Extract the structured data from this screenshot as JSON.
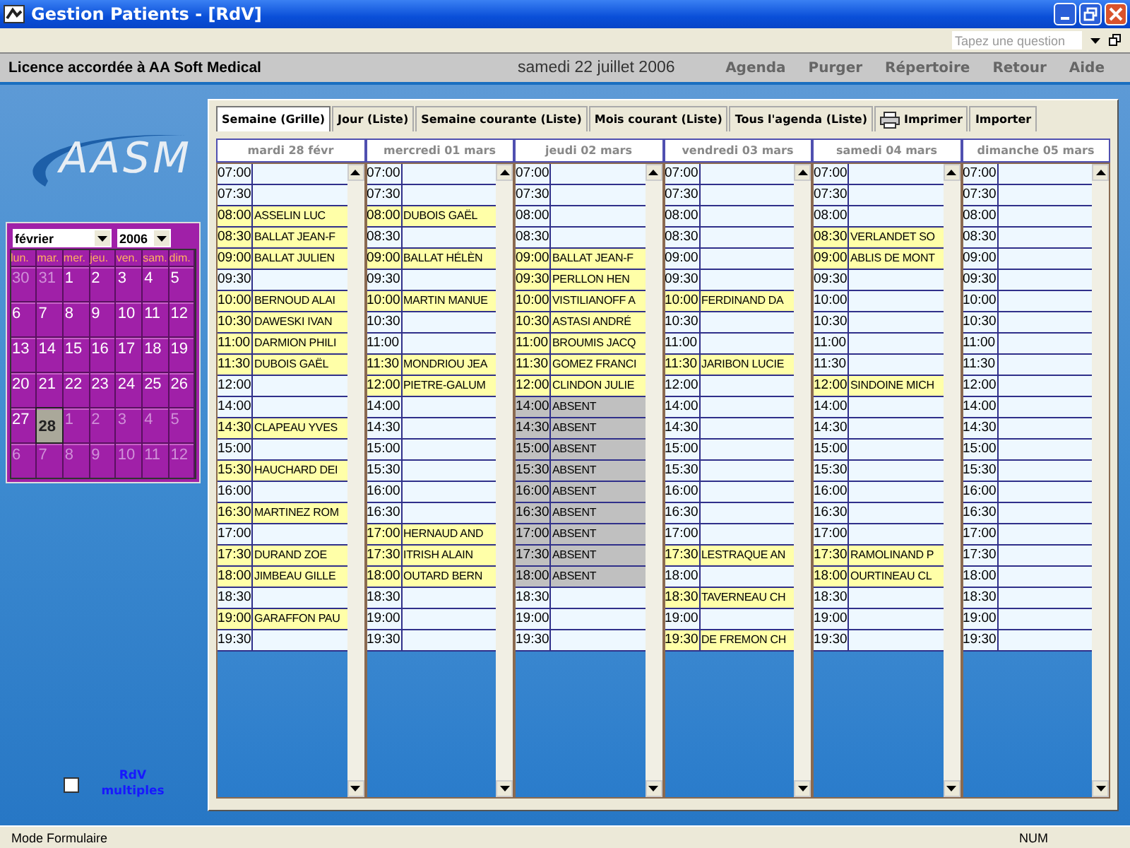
{
  "window": {
    "title": "Gestion Patients - [RdV]"
  },
  "help_box": {
    "placeholder": "Tapez une question"
  },
  "header": {
    "licence": "Licence accordée à  AA Soft Medical",
    "date": "samedi 22 juillet 2006",
    "links": [
      "Agenda",
      "Purger",
      "Répertoire",
      "Retour",
      "Aide"
    ]
  },
  "logo": {
    "text": "AASM"
  },
  "calendar": {
    "month": "février",
    "year": "2006",
    "weekdays": [
      "lun.",
      "mar.",
      "mer.",
      "jeu.",
      "ven.",
      "sam.",
      "dim."
    ],
    "weeks": [
      [
        {
          "day": "30",
          "other_month": true,
          "selected": false
        },
        {
          "day": "31",
          "other_month": true,
          "selected": false
        },
        {
          "day": "1",
          "other_month": false,
          "selected": false
        },
        {
          "day": "2",
          "other_month": false,
          "selected": false
        },
        {
          "day": "3",
          "other_month": false,
          "selected": false
        },
        {
          "day": "4",
          "other_month": false,
          "selected": false
        },
        {
          "day": "5",
          "other_month": false,
          "selected": false
        }
      ],
      [
        {
          "day": "6",
          "other_month": false,
          "selected": false
        },
        {
          "day": "7",
          "other_month": false,
          "selected": false
        },
        {
          "day": "8",
          "other_month": false,
          "selected": false
        },
        {
          "day": "9",
          "other_month": false,
          "selected": false
        },
        {
          "day": "10",
          "other_month": false,
          "selected": false
        },
        {
          "day": "11",
          "other_month": false,
          "selected": false
        },
        {
          "day": "12",
          "other_month": false,
          "selected": false
        }
      ],
      [
        {
          "day": "13",
          "other_month": false,
          "selected": false
        },
        {
          "day": "14",
          "other_month": false,
          "selected": false
        },
        {
          "day": "15",
          "other_month": false,
          "selected": false
        },
        {
          "day": "16",
          "other_month": false,
          "selected": false
        },
        {
          "day": "17",
          "other_month": false,
          "selected": false
        },
        {
          "day": "18",
          "other_month": false,
          "selected": false
        },
        {
          "day": "19",
          "other_month": false,
          "selected": false
        }
      ],
      [
        {
          "day": "20",
          "other_month": false,
          "selected": false
        },
        {
          "day": "21",
          "other_month": false,
          "selected": false
        },
        {
          "day": "22",
          "other_month": false,
          "selected": false
        },
        {
          "day": "23",
          "other_month": false,
          "selected": false
        },
        {
          "day": "24",
          "other_month": false,
          "selected": false
        },
        {
          "day": "25",
          "other_month": false,
          "selected": false
        },
        {
          "day": "26",
          "other_month": false,
          "selected": false
        }
      ],
      [
        {
          "day": "27",
          "other_month": false,
          "selected": false
        },
        {
          "day": "28",
          "other_month": false,
          "selected": true
        },
        {
          "day": "1",
          "other_month": true,
          "selected": false
        },
        {
          "day": "2",
          "other_month": true,
          "selected": false
        },
        {
          "day": "3",
          "other_month": true,
          "selected": false
        },
        {
          "day": "4",
          "other_month": true,
          "selected": false
        },
        {
          "day": "5",
          "other_month": true,
          "selected": false
        }
      ],
      [
        {
          "day": "6",
          "other_month": true,
          "selected": false
        },
        {
          "day": "7",
          "other_month": true,
          "selected": false
        },
        {
          "day": "8",
          "other_month": true,
          "selected": false
        },
        {
          "day": "9",
          "other_month": true,
          "selected": false
        },
        {
          "day": "10",
          "other_month": true,
          "selected": false
        },
        {
          "day": "11",
          "other_month": true,
          "selected": false
        },
        {
          "day": "12",
          "other_month": true,
          "selected": false
        }
      ]
    ]
  },
  "multiple_appointments": {
    "label": "RdV multiples",
    "checked": false
  },
  "tabs": [
    {
      "label": "Semaine (Grille)",
      "kind": "text",
      "selected": true
    },
    {
      "label": "Jour (Liste)",
      "kind": "text",
      "selected": false
    },
    {
      "label": "Semaine courante (Liste)",
      "kind": "text",
      "selected": false
    },
    {
      "label": "Mois courant (Liste)",
      "kind": "text",
      "selected": false
    },
    {
      "label": "Tous l'agenda (Liste)",
      "kind": "text",
      "selected": false
    },
    {
      "label": "Imprimer",
      "kind": "print",
      "selected": false
    },
    {
      "label": "Importer",
      "kind": "text",
      "selected": false
    }
  ],
  "days": [
    {
      "header": "mardi 28 févr",
      "slots": [
        {
          "time": "07:00",
          "kind": "free"
        },
        {
          "time": "07:30",
          "kind": "free"
        },
        {
          "time": "08:00",
          "kind": "booked",
          "name": "ASSELIN LUC"
        },
        {
          "time": "08:30",
          "kind": "booked",
          "name": "BALLAT JEAN-F"
        },
        {
          "time": "09:00",
          "kind": "booked",
          "name": "BALLAT JULIEN"
        },
        {
          "time": "09:30",
          "kind": "free"
        },
        {
          "time": "10:00",
          "kind": "booked",
          "name": "BERNOUD ALAI"
        },
        {
          "time": "10:30",
          "kind": "booked",
          "name": "DAWESKI IVAN"
        },
        {
          "time": "11:00",
          "kind": "booked",
          "name": "DARMION PHILI"
        },
        {
          "time": "11:30",
          "kind": "booked",
          "name": "DUBOIS GAËL"
        },
        {
          "time": "12:00",
          "kind": "free"
        },
        {
          "time": "14:00",
          "kind": "free"
        },
        {
          "time": "14:30",
          "kind": "booked",
          "name": "CLAPEAU YVES"
        },
        {
          "time": "15:00",
          "kind": "free"
        },
        {
          "time": "15:30",
          "kind": "booked",
          "name": "HAUCHARD DEI"
        },
        {
          "time": "16:00",
          "kind": "free"
        },
        {
          "time": "16:30",
          "kind": "booked",
          "name": "MARTINEZ ROM"
        },
        {
          "time": "17:00",
          "kind": "free"
        },
        {
          "time": "17:30",
          "kind": "booked",
          "name": "DURAND ZOE"
        },
        {
          "time": "18:00",
          "kind": "booked",
          "name": "JIMBEAU GILLE"
        },
        {
          "time": "18:30",
          "kind": "free"
        },
        {
          "time": "19:00",
          "kind": "booked",
          "name": "GARAFFON PAU"
        },
        {
          "time": "19:30",
          "kind": "free"
        }
      ]
    },
    {
      "header": "mercredi 01 mars",
      "slots": [
        {
          "time": "07:00",
          "kind": "free"
        },
        {
          "time": "07:30",
          "kind": "free"
        },
        {
          "time": "08:00",
          "kind": "booked",
          "name": "DUBOIS GAËL"
        },
        {
          "time": "08:30",
          "kind": "free"
        },
        {
          "time": "09:00",
          "kind": "booked",
          "name": "BALLAT HÉLÈN"
        },
        {
          "time": "09:30",
          "kind": "free"
        },
        {
          "time": "10:00",
          "kind": "booked",
          "name": "MARTIN MANUE"
        },
        {
          "time": "10:30",
          "kind": "free"
        },
        {
          "time": "11:00",
          "kind": "free"
        },
        {
          "time": "11:30",
          "kind": "booked",
          "name": "MONDRIOU JEA"
        },
        {
          "time": "12:00",
          "kind": "booked",
          "name": "PIETRE-GALUM"
        },
        {
          "time": "14:00",
          "kind": "free"
        },
        {
          "time": "14:30",
          "kind": "free"
        },
        {
          "time": "15:00",
          "kind": "free"
        },
        {
          "time": "15:30",
          "kind": "free"
        },
        {
          "time": "16:00",
          "kind": "free"
        },
        {
          "time": "16:30",
          "kind": "free"
        },
        {
          "time": "17:00",
          "kind": "booked",
          "name": "HERNAUD AND"
        },
        {
          "time": "17:30",
          "kind": "booked",
          "name": "ITRISH ALAIN"
        },
        {
          "time": "18:00",
          "kind": "booked",
          "name": "OUTARD BERN"
        },
        {
          "time": "18:30",
          "kind": "free"
        },
        {
          "time": "19:00",
          "kind": "free"
        },
        {
          "time": "19:30",
          "kind": "free"
        }
      ]
    },
    {
      "header": "jeudi 02 mars",
      "slots": [
        {
          "time": "07:00",
          "kind": "free"
        },
        {
          "time": "07:30",
          "kind": "free"
        },
        {
          "time": "08:00",
          "kind": "free"
        },
        {
          "time": "08:30",
          "kind": "free"
        },
        {
          "time": "09:00",
          "kind": "booked",
          "name": "BALLAT JEAN-F"
        },
        {
          "time": "09:30",
          "kind": "booked",
          "name": "PERLLON HEN"
        },
        {
          "time": "10:00",
          "kind": "booked",
          "name": "VISTILIANOFF A"
        },
        {
          "time": "10:30",
          "kind": "booked",
          "name": "ASTASI ANDRÉ"
        },
        {
          "time": "11:00",
          "kind": "booked",
          "name": "BROUMIS JACQ"
        },
        {
          "time": "11:30",
          "kind": "booked",
          "name": "GOMEZ FRANCI"
        },
        {
          "time": "12:00",
          "kind": "booked",
          "name": "CLINDON JULIE"
        },
        {
          "time": "14:00",
          "kind": "absent",
          "name": "ABSENT"
        },
        {
          "time": "14:30",
          "kind": "absent",
          "name": "ABSENT"
        },
        {
          "time": "15:00",
          "kind": "absent",
          "name": "ABSENT"
        },
        {
          "time": "15:30",
          "kind": "absent",
          "name": "ABSENT"
        },
        {
          "time": "16:00",
          "kind": "absent",
          "name": "ABSENT"
        },
        {
          "time": "16:30",
          "kind": "absent",
          "name": "ABSENT"
        },
        {
          "time": "17:00",
          "kind": "absent",
          "name": "ABSENT"
        },
        {
          "time": "17:30",
          "kind": "absent",
          "name": "ABSENT"
        },
        {
          "time": "18:00",
          "kind": "absent",
          "name": "ABSENT"
        },
        {
          "time": "18:30",
          "kind": "free"
        },
        {
          "time": "19:00",
          "kind": "free"
        },
        {
          "time": "19:30",
          "kind": "free"
        }
      ]
    },
    {
      "header": "vendredi 03 mars",
      "slots": [
        {
          "time": "07:00",
          "kind": "free"
        },
        {
          "time": "07:30",
          "kind": "free"
        },
        {
          "time": "08:00",
          "kind": "free"
        },
        {
          "time": "08:30",
          "kind": "free"
        },
        {
          "time": "09:00",
          "kind": "free"
        },
        {
          "time": "09:30",
          "kind": "free"
        },
        {
          "time": "10:00",
          "kind": "booked",
          "name": "FERDINAND DA"
        },
        {
          "time": "10:30",
          "kind": "free"
        },
        {
          "time": "11:00",
          "kind": "free"
        },
        {
          "time": "11:30",
          "kind": "booked",
          "name": "JARIBON LUCIE"
        },
        {
          "time": "12:00",
          "kind": "free"
        },
        {
          "time": "14:00",
          "kind": "free"
        },
        {
          "time": "14:30",
          "kind": "free"
        },
        {
          "time": "15:00",
          "kind": "free"
        },
        {
          "time": "15:30",
          "kind": "free"
        },
        {
          "time": "16:00",
          "kind": "free"
        },
        {
          "time": "16:30",
          "kind": "free"
        },
        {
          "time": "17:00",
          "kind": "free"
        },
        {
          "time": "17:30",
          "kind": "booked",
          "name": "LESTRAQUE AN"
        },
        {
          "time": "18:00",
          "kind": "free"
        },
        {
          "time": "18:30",
          "kind": "booked",
          "name": "TAVERNEAU CH"
        },
        {
          "time": "19:00",
          "kind": "free"
        },
        {
          "time": "19:30",
          "kind": "booked",
          "name": "DE FREMON CH"
        }
      ]
    },
    {
      "header": "samedi 04 mars",
      "slots": [
        {
          "time": "07:00",
          "kind": "free"
        },
        {
          "time": "07:30",
          "kind": "free"
        },
        {
          "time": "08:00",
          "kind": "free"
        },
        {
          "time": "08:30",
          "kind": "booked",
          "name": "VERLANDET SO"
        },
        {
          "time": "09:00",
          "kind": "booked",
          "name": "ABLIS DE MONT"
        },
        {
          "time": "09:30",
          "kind": "free"
        },
        {
          "time": "10:00",
          "kind": "free"
        },
        {
          "time": "10:30",
          "kind": "free"
        },
        {
          "time": "11:00",
          "kind": "free"
        },
        {
          "time": "11:30",
          "kind": "free"
        },
        {
          "time": "12:00",
          "kind": "booked",
          "name": "SINDOINE MICH"
        },
        {
          "time": "14:00",
          "kind": "free"
        },
        {
          "time": "14:30",
          "kind": "free"
        },
        {
          "time": "15:00",
          "kind": "free"
        },
        {
          "time": "15:30",
          "kind": "free"
        },
        {
          "time": "16:00",
          "kind": "free"
        },
        {
          "time": "16:30",
          "kind": "free"
        },
        {
          "time": "17:00",
          "kind": "free"
        },
        {
          "time": "17:30",
          "kind": "booked",
          "name": "RAMOLINAND P"
        },
        {
          "time": "18:00",
          "kind": "booked",
          "name": "OURTINEAU CL"
        },
        {
          "time": "18:30",
          "kind": "free"
        },
        {
          "time": "19:00",
          "kind": "free"
        },
        {
          "time": "19:30",
          "kind": "free"
        }
      ]
    },
    {
      "header": "dimanche 05 mars",
      "slots": [
        {
          "time": "07:00",
          "kind": "free"
        },
        {
          "time": "07:30",
          "kind": "free"
        },
        {
          "time": "08:00",
          "kind": "free"
        },
        {
          "time": "08:30",
          "kind": "free"
        },
        {
          "time": "09:00",
          "kind": "free"
        },
        {
          "time": "09:30",
          "kind": "free"
        },
        {
          "time": "10:00",
          "kind": "free"
        },
        {
          "time": "10:30",
          "kind": "free"
        },
        {
          "time": "11:00",
          "kind": "free"
        },
        {
          "time": "11:30",
          "kind": "free"
        },
        {
          "time": "12:00",
          "kind": "free"
        },
        {
          "time": "14:00",
          "kind": "free"
        },
        {
          "time": "14:30",
          "kind": "free"
        },
        {
          "time": "15:00",
          "kind": "free"
        },
        {
          "time": "15:30",
          "kind": "free"
        },
        {
          "time": "16:00",
          "kind": "free"
        },
        {
          "time": "16:30",
          "kind": "free"
        },
        {
          "time": "17:00",
          "kind": "free"
        },
        {
          "time": "17:30",
          "kind": "free"
        },
        {
          "time": "18:00",
          "kind": "free"
        },
        {
          "time": "18:30",
          "kind": "free"
        },
        {
          "time": "19:00",
          "kind": "free"
        },
        {
          "time": "19:30",
          "kind": "free"
        }
      ]
    }
  ],
  "status_bar": {
    "mode": "Mode Formulaire",
    "num": "NUM"
  }
}
